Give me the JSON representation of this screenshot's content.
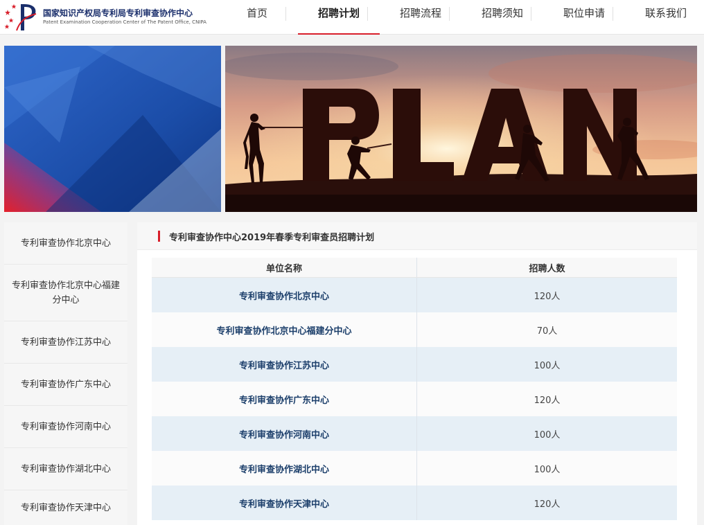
{
  "header": {
    "org_name_cn": "国家知识产权局专利局专利审查协作中心",
    "org_name_en": "Patent Examination Cooperation Center of The Patent Office, CNIPA",
    "nav": [
      {
        "label": "首页",
        "active": false
      },
      {
        "label": "招聘计划",
        "active": true
      },
      {
        "label": "招聘流程",
        "active": false
      },
      {
        "label": "招聘须知",
        "active": false
      },
      {
        "label": "职位申请",
        "active": false
      },
      {
        "label": "联系我们",
        "active": false
      }
    ]
  },
  "banner": {
    "headline": "PLAN"
  },
  "sidebar": {
    "items": [
      "专利审查协作北京中心",
      "专利审查协作北京中心福建分中心",
      "专利审查协作江苏中心",
      "专利审查协作广东中心",
      "专利审查协作河南中心",
      "专利审查协作湖北中心",
      "专利审查协作天津中心"
    ]
  },
  "main": {
    "title": "专利审查协作中心2019年春季专利审查员招聘计划",
    "table": {
      "headers": [
        "单位名称",
        "招聘人数"
      ],
      "rows": [
        [
          "专利审查协作北京中心",
          "120人"
        ],
        [
          "专利审查协作北京中心福建分中心",
          "70人"
        ],
        [
          "专利审查协作江苏中心",
          "100人"
        ],
        [
          "专利审查协作广东中心",
          "120人"
        ],
        [
          "专利审查协作河南中心",
          "100人"
        ],
        [
          "专利审查协作湖北中心",
          "100人"
        ],
        [
          "专利审查协作天津中心",
          "120人"
        ]
      ]
    }
  },
  "colors": {
    "accent_red": "#d81e2a",
    "nav_text": "#333333",
    "logo_blue": "#1a2e6b",
    "row_stripe": "#e6eff6",
    "row_text_blue": "#1c3f6b"
  }
}
